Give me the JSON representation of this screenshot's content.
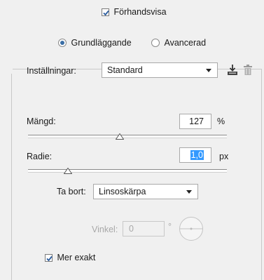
{
  "preview": {
    "label": "Förhandsvisa",
    "checked": true
  },
  "mode": {
    "basic_label": "Grundläggande",
    "advanced_label": "Avancerad",
    "selected": "Grundläggande"
  },
  "settings": {
    "label": "Inställningar:",
    "value": "Standard",
    "save_icon": "save-settings-icon",
    "delete_icon": "trash-icon"
  },
  "amount": {
    "label": "Mängd:",
    "value": "127",
    "unit": "%",
    "slider_level": 0.46
  },
  "radius": {
    "label": "Radie:",
    "value": "1,0",
    "unit": "px",
    "slider_level": 0.2
  },
  "remove": {
    "label": "Ta bort:",
    "value": "Linsoskärpa"
  },
  "angle": {
    "label": "Vinkel:",
    "value": "0",
    "unit": "°",
    "dial_icon": "angle-dial-icon"
  },
  "more_accurate": {
    "label": "Mer exakt",
    "checked": true
  }
}
